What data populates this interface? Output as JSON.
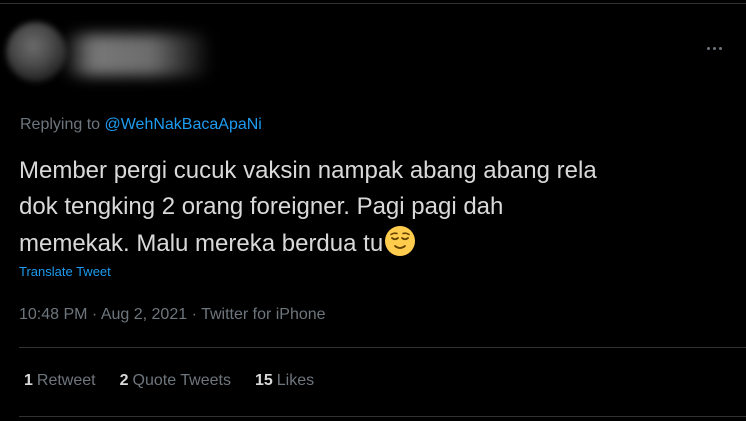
{
  "tweet": {
    "replying_prefix": "Replying to ",
    "replying_handle": "@WehNakBacaApaNi",
    "text_line1": "Member pergi cucuk vaksin nampak abang abang rela",
    "text_line2": "dok tengking 2 orang foreigner. Pagi pagi dah",
    "text_line3": "memekak. Malu mereka berdua tu",
    "emoji": "relieved-face-emoji",
    "translate_label": "Translate Tweet",
    "time": "10:48 PM",
    "separator1": " · ",
    "date": "Aug 2, 2021",
    "separator2": " · ",
    "source": "Twitter for iPhone"
  },
  "stats": {
    "retweets_count": "1",
    "retweets_label": "Retweet",
    "quote_count": "2",
    "quote_label": "Quote Tweets",
    "likes_count": "15",
    "likes_label": "Likes"
  },
  "icons": {
    "more": "more-horizontal-icon"
  },
  "colors": {
    "background": "#000000",
    "text": "#d9d9d9",
    "muted": "#6e767d",
    "link": "#1d9bf0",
    "divider": "#2f3336"
  }
}
